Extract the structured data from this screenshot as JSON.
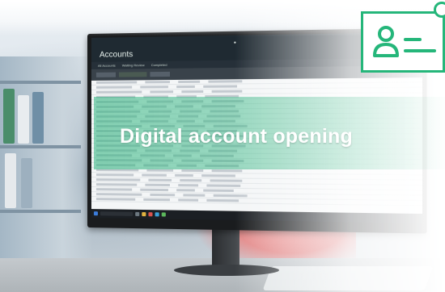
{
  "headline": "Digital account opening",
  "app": {
    "title": "Accounts",
    "tabs": [
      "All Accounts",
      "Waiting Review",
      "Completed"
    ]
  },
  "colors": {
    "accent_green": "#25b67a",
    "band_green": "#2bb47d"
  },
  "icons": {
    "badge": "id-card-icon",
    "person": "person-icon"
  }
}
